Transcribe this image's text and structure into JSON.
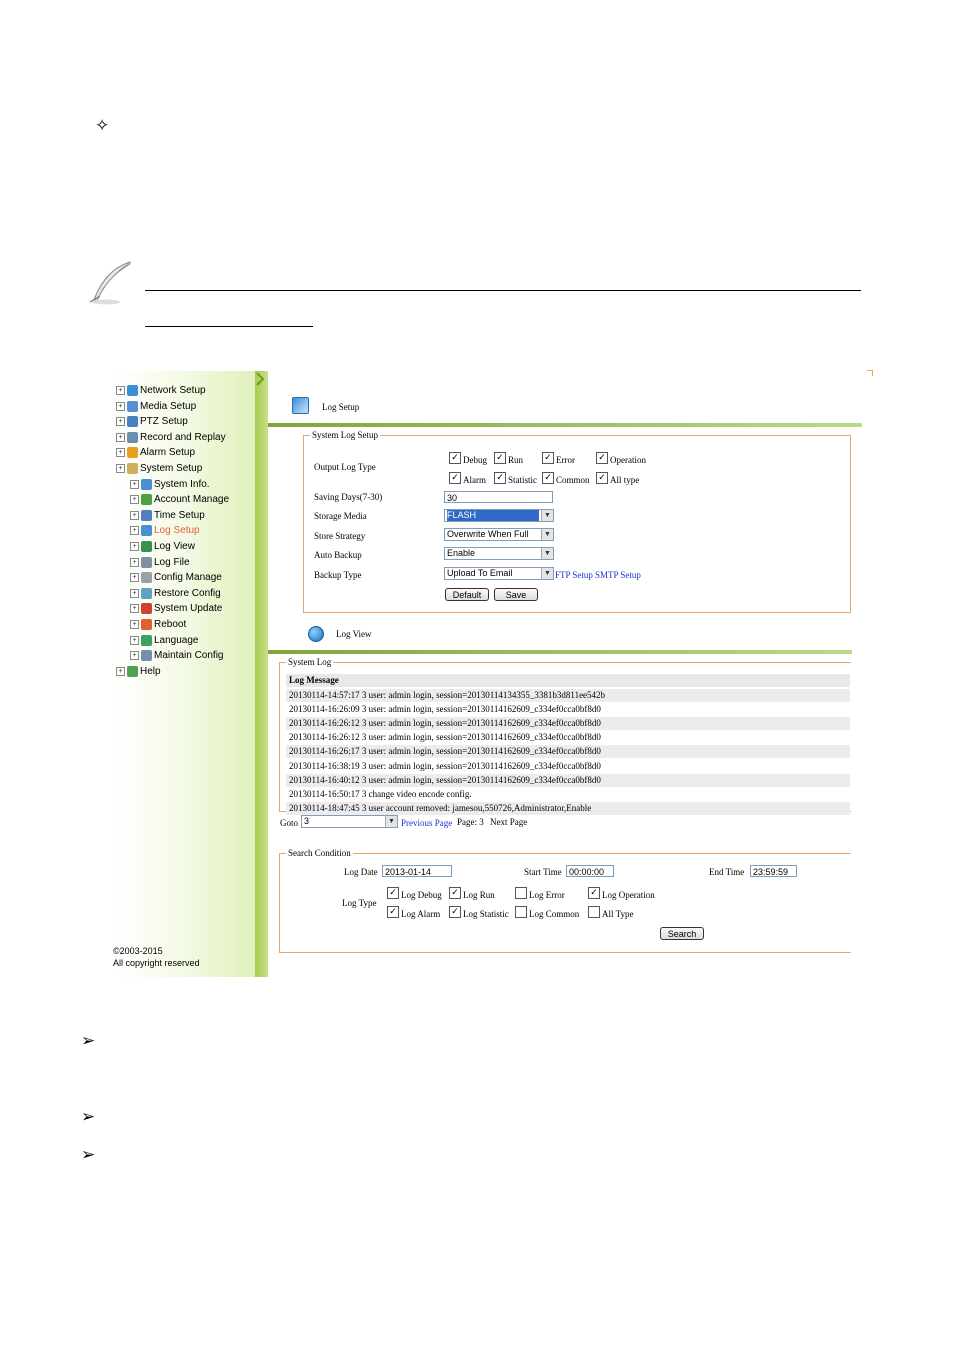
{
  "sidebar": {
    "items": [
      {
        "label": "Network Setup",
        "level": 0,
        "icon": "globe-icon",
        "color": "#3a8fd8"
      },
      {
        "label": "Media Setup",
        "level": 0,
        "icon": "media-icon",
        "color": "#5a8fd0"
      },
      {
        "label": "PTZ Setup",
        "level": 0,
        "icon": "ptz-icon",
        "color": "#4a7fc0"
      },
      {
        "label": "Record and Replay",
        "level": 0,
        "icon": "record-icon",
        "color": "#6a8fb0"
      },
      {
        "label": "Alarm Setup",
        "level": 0,
        "icon": "alarm-icon",
        "color": "#e8a020"
      },
      {
        "label": "System Setup",
        "level": 0,
        "icon": "system-icon",
        "color": "#d0b060"
      },
      {
        "label": "System Info.",
        "level": 1,
        "icon": "info-icon",
        "color": "#4a90d0"
      },
      {
        "label": "Account Manage",
        "level": 1,
        "icon": "account-icon",
        "color": "#50a040"
      },
      {
        "label": "Time Setup",
        "level": 1,
        "icon": "clock-icon",
        "color": "#5080c0"
      },
      {
        "label": "Log Setup",
        "level": 1,
        "icon": "log-setup-icon",
        "color": "#4a90d0",
        "active": true
      },
      {
        "label": "Log View",
        "level": 1,
        "icon": "log-view-icon",
        "color": "#3a9050"
      },
      {
        "label": "Log File",
        "level": 1,
        "icon": "log-file-icon",
        "color": "#8090a0"
      },
      {
        "label": "Config Manage",
        "level": 1,
        "icon": "config-icon",
        "color": "#9aa0a8"
      },
      {
        "label": "Restore Config",
        "level": 1,
        "icon": "restore-icon",
        "color": "#60a0c0"
      },
      {
        "label": "System Update",
        "level": 1,
        "icon": "update-icon",
        "color": "#d04030"
      },
      {
        "label": "Reboot",
        "level": 1,
        "icon": "reboot-icon",
        "color": "#e06030"
      },
      {
        "label": "Language",
        "level": 1,
        "icon": "language-icon",
        "color": "#40a060"
      },
      {
        "label": "Maintain Config",
        "level": 1,
        "icon": "maintain-icon",
        "color": "#7090b0"
      },
      {
        "label": "Help",
        "level": 0,
        "icon": "help-icon",
        "color": "#50a050"
      }
    ],
    "copyright_line1": "©2003-2015",
    "copyright_line2": "All copyright reserved"
  },
  "log_setup": {
    "title": "Log Setup",
    "legend": "System Log Setup",
    "output_label": "Output Log Type",
    "types": [
      {
        "label": "Debug",
        "checked": true
      },
      {
        "label": "Run",
        "checked": true
      },
      {
        "label": "Error",
        "checked": true
      },
      {
        "label": "Operation",
        "checked": true
      },
      {
        "label": "Alarm",
        "checked": true
      },
      {
        "label": "Statistic",
        "checked": true
      },
      {
        "label": "Common",
        "checked": true
      },
      {
        "label": "All type",
        "checked": true
      }
    ],
    "saving_days_label": "Saving Days(7-30)",
    "saving_days_value": "30",
    "storage_media_label": "Storage Media",
    "storage_media_value": "FLASH",
    "store_strategy_label": "Store Strategy",
    "store_strategy_value": "Overwrite When Full",
    "auto_backup_label": "Auto Backup",
    "auto_backup_value": "Enable",
    "backup_type_label": "Backup Type",
    "backup_type_value": "Upload To Email",
    "ftp_link": "FTP Setup",
    "smtp_link": "SMTP Setup",
    "default_button": "Default",
    "save_button": "Save"
  },
  "log_view": {
    "title": "Log View",
    "legend": "System Log",
    "header": "Log Message",
    "rows": [
      "20130114-14:57:17 3 user: admin login, session=20130114134355_3381b3d811ee542b",
      "20130114-16:26:09 3 user: admin login, session=20130114162609_c334ef0cca0bf8d0",
      "20130114-16:26:12 3 user: admin login, session=20130114162609_c334ef0cca0bf8d0",
      "20130114-16:26:12 3 user: admin login, session=20130114162609_c334ef0cca0bf8d0",
      "20130114-16:26:17 3 user: admin login, session=20130114162609_c334ef0cca0bf8d0",
      "20130114-16:38:19 3 user: admin login, session=20130114162609_c334ef0cca0bf8d0",
      "20130114-16:40:12 3 user: admin login, session=20130114162609_c334ef0cca0bf8d0",
      "20130114-16:50:17 3 change video encode config.",
      "20130114-18:47:45 3 user account removed: jamesou,550726,Administrator,Enable"
    ],
    "goto_label": "Goto",
    "goto_value": "3",
    "prev_link": "Previous Page",
    "page_text": "Page: 3",
    "next_text": "Next Page"
  },
  "search": {
    "legend": "Search Condition",
    "log_date_label": "Log Date",
    "log_date_value": "2013-01-14",
    "start_time_label": "Start Time",
    "start_time_value": "00:00:00",
    "end_time_label": "End Time",
    "end_time_value": "23:59:59",
    "log_type_label": "Log Type",
    "types": [
      {
        "label": "Log Debug",
        "checked": true
      },
      {
        "label": "Log Run",
        "checked": true
      },
      {
        "label": "Log Error",
        "checked": false
      },
      {
        "label": "Log Operation",
        "checked": true
      },
      {
        "label": "Log Alarm",
        "checked": true
      },
      {
        "label": "Log Statistic",
        "checked": true
      },
      {
        "label": "Log Common",
        "checked": false
      },
      {
        "label": "All Type",
        "checked": false
      }
    ],
    "search_button": "Search"
  },
  "colors": {
    "fieldset_border": "#e8a66b",
    "sidebar_green": "#a6cc52",
    "link_blue": "#1a33cc",
    "active_item": "#e8603a"
  },
  "glyphs": {
    "star": "✧",
    "arrow": "➢",
    "check": "✓",
    "plus": "+",
    "dropdown": "▼"
  }
}
